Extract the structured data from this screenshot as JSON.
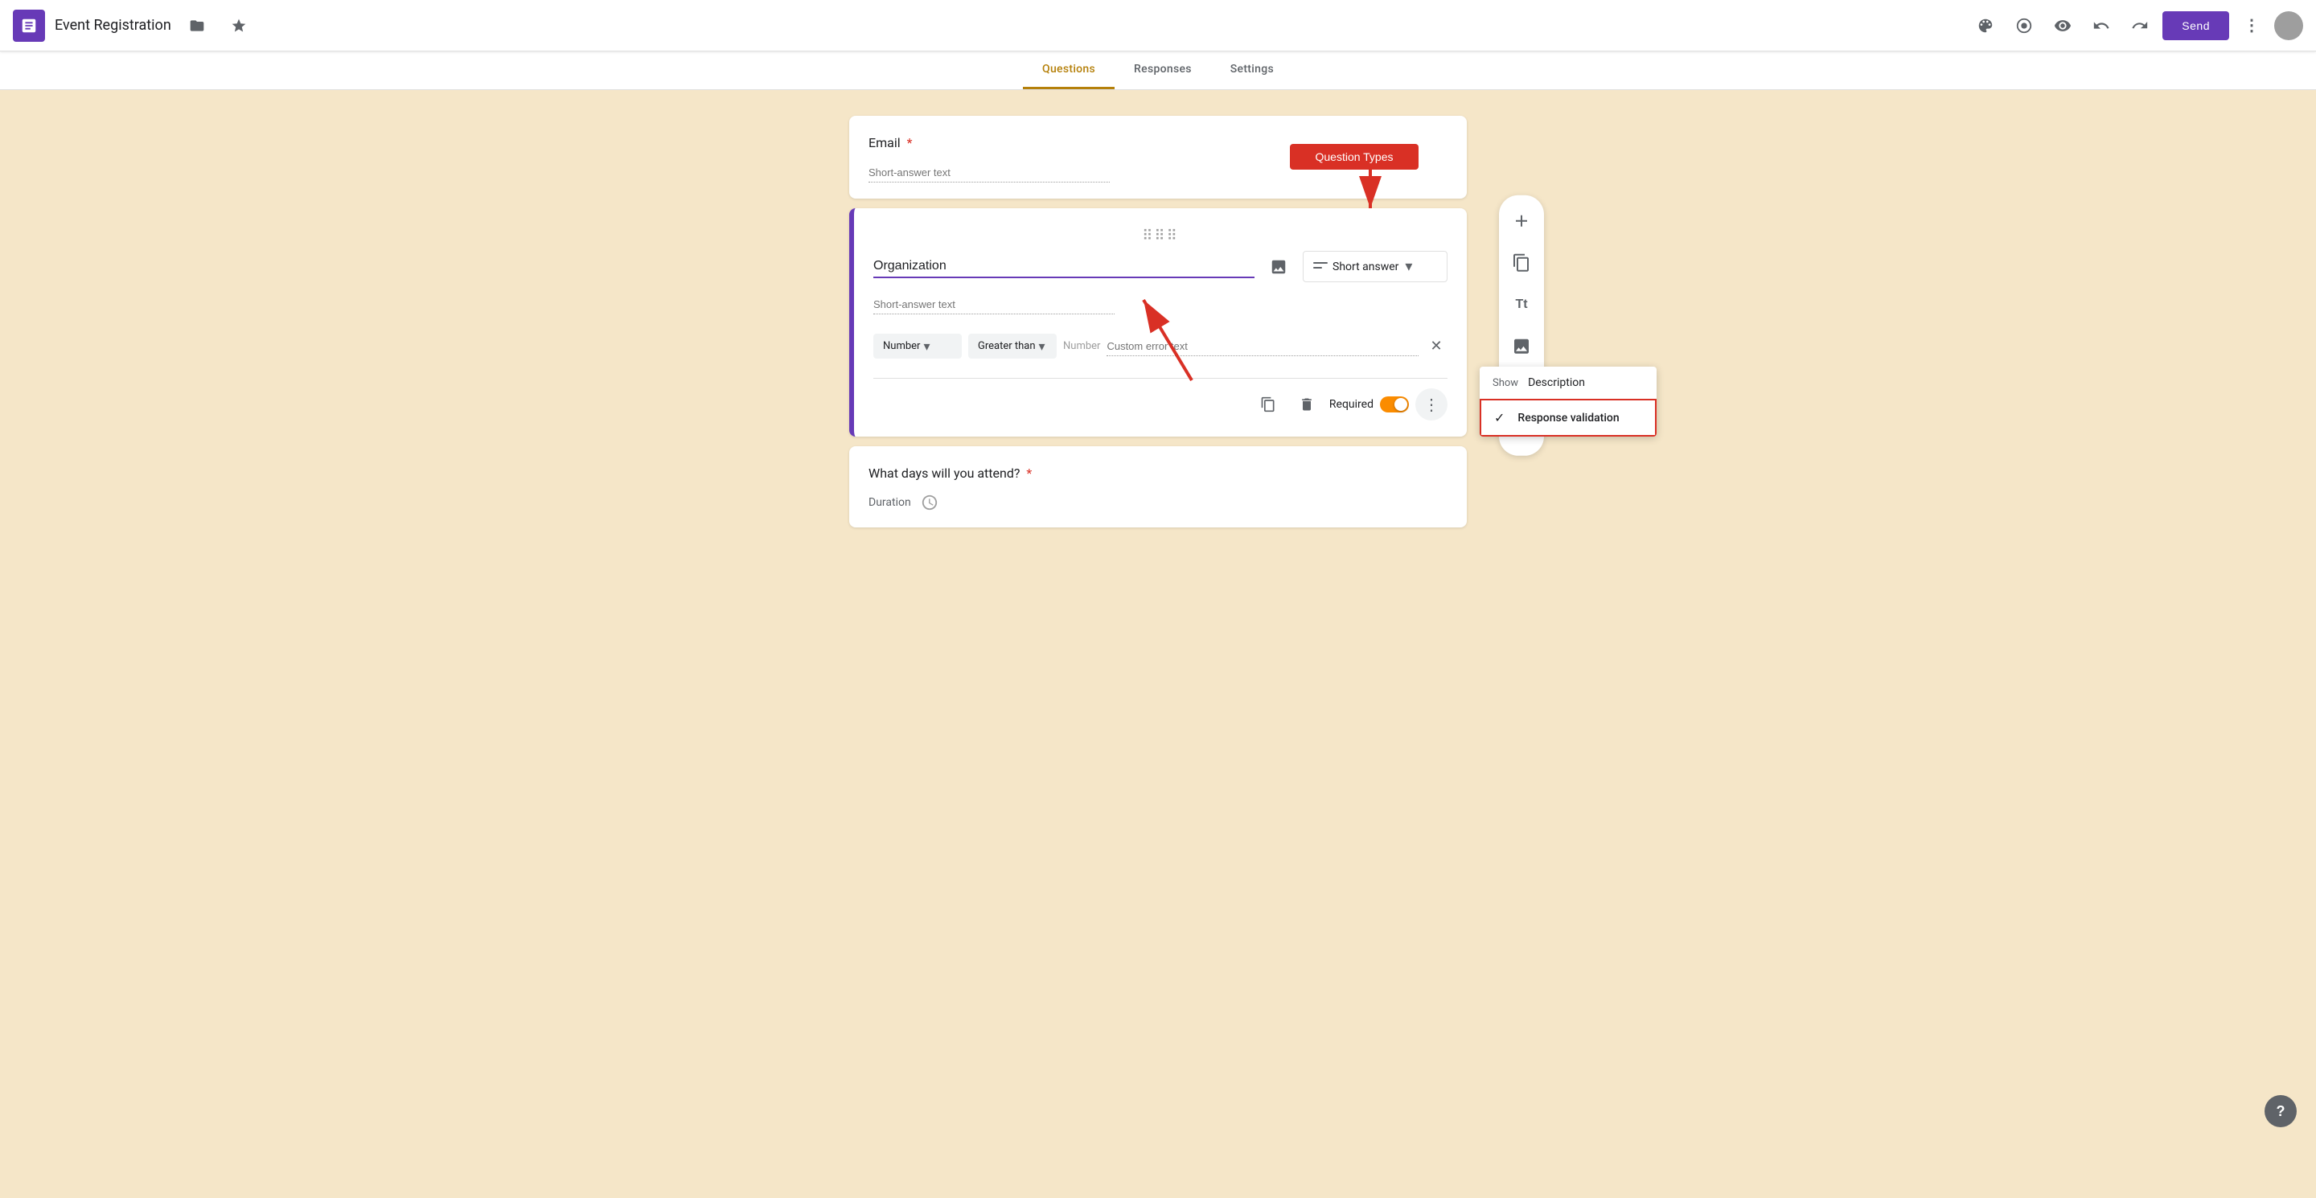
{
  "app": {
    "title": "Event Registration",
    "icon_label": "forms-icon",
    "send_label": "Send"
  },
  "nav": {
    "tabs": [
      {
        "label": "Questions",
        "active": true
      },
      {
        "label": "Responses",
        "active": false
      },
      {
        "label": "Settings",
        "active": false
      }
    ]
  },
  "cards": {
    "email": {
      "label": "Email",
      "required": true,
      "placeholder": "Short-answer text"
    },
    "organization": {
      "drag_handle": "⠿⠿",
      "label": "Organization",
      "answer_placeholder": "Short-answer text",
      "type_icon": "short-answer-icon",
      "type_label": "Short answer",
      "validation": {
        "type_label": "Number",
        "condition_label": "Greater than",
        "value_placeholder": "Number",
        "error_placeholder": "Custom error text"
      },
      "required_label": "Required",
      "required_on": true
    },
    "days": {
      "label": "What days will you attend?",
      "required": true,
      "duration_label": "Duration"
    }
  },
  "side_toolbar": {
    "tools": [
      {
        "name": "add-question",
        "icon": "+"
      },
      {
        "name": "import-questions",
        "icon": "⧉"
      },
      {
        "name": "add-title",
        "icon": "Tt"
      },
      {
        "name": "add-image",
        "icon": "🖼"
      },
      {
        "name": "add-video",
        "icon": "▶"
      },
      {
        "name": "add-section",
        "icon": "≡"
      }
    ]
  },
  "context_menu": {
    "items": [
      {
        "label": "Show",
        "sub": "Description",
        "name": "show-description"
      },
      {
        "label": "Response validation",
        "name": "response-validation",
        "checked": true
      }
    ]
  },
  "annotation": {
    "question_types_label": "Question Types"
  }
}
